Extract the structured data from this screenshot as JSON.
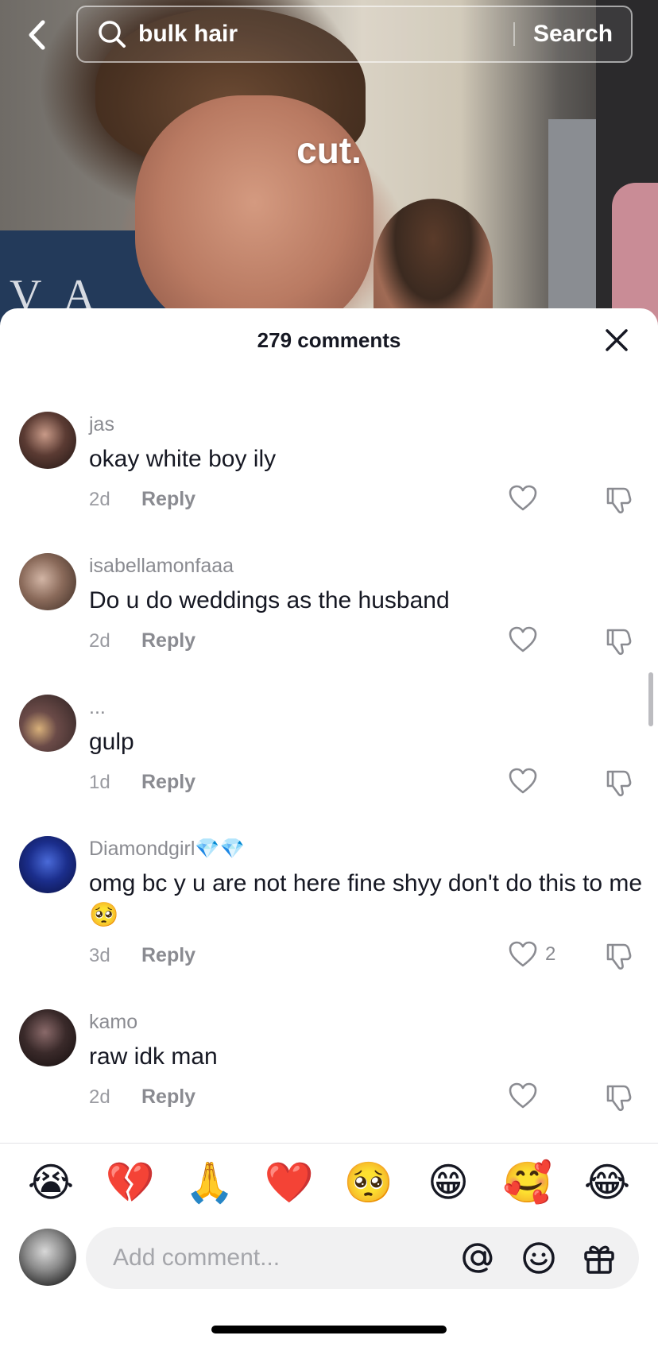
{
  "search": {
    "query": "bulk hair",
    "button_label": "Search"
  },
  "video": {
    "caption": "cut."
  },
  "comments_sheet": {
    "title": "279 comments",
    "comments": [
      {
        "username": "jas",
        "text": "okay white boy ily",
        "time": "2d",
        "reply_label": "Reply",
        "likes": "",
        "avatar_color": "#5b3b33"
      },
      {
        "username": "isabellamonfaaa",
        "text": "Do u do weddings as the husband",
        "time": "2d",
        "reply_label": "Reply",
        "likes": "",
        "avatar_color": "#8a6a5a"
      },
      {
        "username": "...",
        "text": "gulp",
        "time": "1d",
        "reply_label": "Reply",
        "likes": "",
        "avatar_color": "#6b4b48"
      },
      {
        "username": "Diamondgirl💎💎",
        "text": "omg bc y u are not here fine shyy don't do this to me 🥺",
        "time": "3d",
        "reply_label": "Reply",
        "likes": "2",
        "avatar_color": "#1b2e8c"
      },
      {
        "username": "kamo",
        "text": "raw idk man",
        "time": "2d",
        "reply_label": "Reply",
        "likes": "",
        "avatar_color": "#3a2a2a"
      }
    ]
  },
  "quick_emojis": [
    "😭",
    "💔",
    "🙏",
    "❤️",
    "🥺",
    "😁",
    "🥰",
    "😂"
  ],
  "composer": {
    "placeholder": "Add comment..."
  }
}
